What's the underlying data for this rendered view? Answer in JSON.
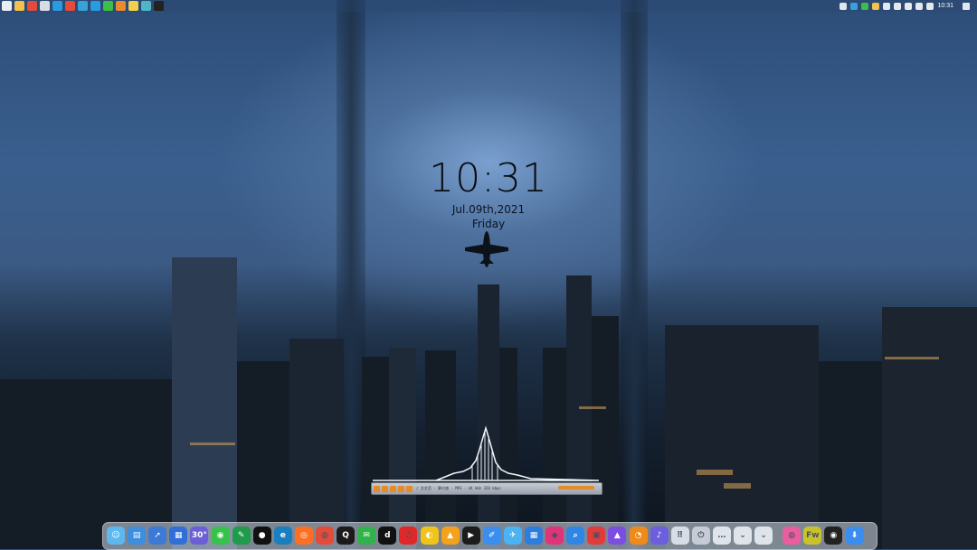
{
  "clock_widget": {
    "time": "10:31",
    "date": "Jul.09th,2021",
    "day": "Friday"
  },
  "taskbar": {
    "clock": "10:31",
    "left_apps": [
      {
        "icon": "start-grid-icon",
        "color": "#e9eef5"
      },
      {
        "icon": "folder-icon",
        "color": "#f2c14e"
      },
      {
        "icon": "chrome-icon",
        "color": "#e44b3b"
      },
      {
        "icon": "file-icon",
        "color": "#d8dde4"
      },
      {
        "icon": "telegram-icon",
        "color": "#2a9be0"
      },
      {
        "icon": "chrome-icon",
        "color": "#e44b3b"
      },
      {
        "icon": "remote-desktop-icon",
        "color": "#3aa0d8"
      },
      {
        "icon": "telegram-icon",
        "color": "#2a9be0"
      },
      {
        "icon": "green-app-icon",
        "color": "#3cbf4a"
      },
      {
        "icon": "player-icon",
        "color": "#e88a2d"
      },
      {
        "icon": "film-icon",
        "color": "#f2d04e"
      },
      {
        "icon": "app-icon",
        "color": "#4fb6c8"
      },
      {
        "icon": "dark-circle-icon",
        "color": "#222"
      }
    ],
    "tray": [
      {
        "icon": "tray-app-icon",
        "color": "#dfe6ef"
      },
      {
        "icon": "tray-app-icon",
        "color": "#3aa0d8"
      },
      {
        "icon": "tray-app-icon",
        "color": "#3cbf4a"
      },
      {
        "icon": "tray-app-icon",
        "color": "#f2c14e"
      },
      {
        "icon": "tray-app-icon",
        "color": "#e5e9ef"
      },
      {
        "icon": "wifi-icon",
        "color": "#e5e9ef"
      },
      {
        "icon": "volume-icon",
        "color": "#e5e9ef"
      },
      {
        "icon": "language-icon",
        "color": "#e5e9ef"
      },
      {
        "icon": "settings-icon",
        "color": "#e5e9ef"
      }
    ]
  },
  "player": {
    "info": "♪ 文艺范 · 夢の旅 · MP3 · 44 kHz 320 kbps"
  },
  "dock": [
    {
      "name": "finder-icon",
      "color": "#5db8ef",
      "glyph": "☺"
    },
    {
      "name": "printer-icon",
      "color": "#3e8ee0",
      "glyph": "▤"
    },
    {
      "name": "launchpad-icon",
      "color": "#3b7ad6",
      "glyph": "➚"
    },
    {
      "name": "windows-icon",
      "color": "#2f6fd8",
      "glyph": "▦"
    },
    {
      "name": "weather-icon",
      "color": "#6a5fd6",
      "glyph": "30°"
    },
    {
      "name": "chat-icon",
      "color": "#37c24a",
      "glyph": "◉"
    },
    {
      "name": "evernote-icon",
      "color": "#1f9b4b",
      "glyph": "✎"
    },
    {
      "name": "notion-icon",
      "color": "#111111",
      "glyph": "●"
    },
    {
      "name": "edge-icon",
      "color": "#1a7fc1",
      "glyph": "e"
    },
    {
      "name": "firefox-icon",
      "color": "#ff6f22",
      "glyph": "◎"
    },
    {
      "name": "chrome-icon",
      "color": "#e44b3b",
      "glyph": "◍"
    },
    {
      "name": "qq-icon",
      "color": "#1b1b1b",
      "glyph": "Q"
    },
    {
      "name": "wechat-icon",
      "color": "#2fb34a",
      "glyph": "✉"
    },
    {
      "name": "tiktok-icon",
      "color": "#111111",
      "glyph": "d"
    },
    {
      "name": "netease-music-icon",
      "color": "#e02828",
      "glyph": "♫"
    },
    {
      "name": "yellow-app-icon",
      "color": "#f0c419",
      "glyph": "◐"
    },
    {
      "name": "vpn-icon",
      "color": "#f4a21a",
      "glyph": "▲"
    },
    {
      "name": "media-icon",
      "color": "#1c1c1c",
      "glyph": "▶"
    },
    {
      "name": "pen-icon",
      "color": "#3a8ef0",
      "glyph": "✐"
    },
    {
      "name": "bird-icon",
      "color": "#4ab3f4",
      "glyph": "✈"
    },
    {
      "name": "grid-app-icon",
      "color": "#2b7de0",
      "glyph": "▦"
    },
    {
      "name": "tag-icon",
      "color": "#e0337a",
      "glyph": "◆"
    },
    {
      "name": "search-icon",
      "color": "#2f86e6",
      "glyph": "⌕"
    },
    {
      "name": "screenshot-icon",
      "color": "#e23b3b",
      "glyph": "▣"
    },
    {
      "name": "gallery-icon",
      "color": "#7b4de0",
      "glyph": "▲"
    },
    {
      "name": "dial-icon",
      "color": "#f08a19",
      "glyph": "◔"
    },
    {
      "name": "sound-icon",
      "color": "#6b5fe0",
      "glyph": "♪"
    },
    {
      "name": "app-grid-icon",
      "color": "#d7dde6",
      "glyph": "⠿"
    },
    {
      "name": "power-icon",
      "color": "#c6ccd6",
      "glyph": "⏻"
    },
    {
      "name": "more-icon",
      "color": "#dfe4ea",
      "glyph": "…"
    },
    {
      "name": "chevron-down-icon",
      "color": "#dfe4ea",
      "glyph": "⌄"
    },
    {
      "name": "chevron-down-icon",
      "color": "#dfe4ea",
      "glyph": "⌄"
    },
    {
      "name": "color-wheel-icon",
      "color": "#ea5d9e",
      "glyph": "◍"
    },
    {
      "name": "fireworks-icon",
      "color": "#c9c22a",
      "glyph": "Fw"
    },
    {
      "name": "obs-icon",
      "color": "#222222",
      "glyph": "◉"
    },
    {
      "name": "installer-icon",
      "color": "#3a8ef0",
      "glyph": "⬇"
    }
  ]
}
